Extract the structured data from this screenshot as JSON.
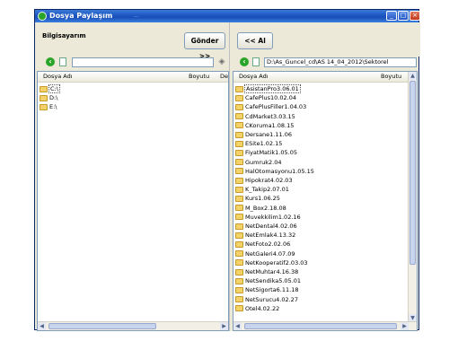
{
  "window": {
    "title": "Dosya Paylaşım",
    "faint_title_text": "...",
    "buttons": {
      "minimize": "_",
      "maximize": "□",
      "close": "×"
    }
  },
  "left": {
    "panel_title": "Bilgisayarım",
    "send_button": "Gönder >>",
    "path": "",
    "columns": {
      "name": "Dosya Adı",
      "size": "Boyutu",
      "modified": "Değ"
    },
    "items": [
      "C:\\",
      "D:\\",
      "E:\\"
    ],
    "selected_index": 0
  },
  "right": {
    "get_all_button": "<< Al",
    "path": "D:\\As_Guncel_cd\\AS 14_04_2012\\Sektorel",
    "columns": {
      "name": "Dosya Adı",
      "size": "Boyutu"
    },
    "items": [
      "AsistanPro3.06.01",
      "CafePlus10.02.04",
      "CafePlusFiller1.04.03",
      "CdMarket3.03.15",
      "CKoruma1.08.15",
      "Dersane1.11.06",
      "ESite1.02.15",
      "FiyatMatik1.05.05",
      "Gumruk2.04",
      "HalOtomasyonu1.05.15",
      "Hipokrat4.02.03",
      "K_Takip2.07.01",
      "Kurs1.06.25",
      "M_Box2.18.08",
      "Muvekkilim1.02.16",
      "NetDental4.02.06",
      "NetEmlak4.13.32",
      "NetFoto2.02.06",
      "NetGaleri4.07.09",
      "NetKooperatif2.03.03",
      "NetMuhtar4.16.38",
      "NetSendika5.05.01",
      "NetSigorta6.11.18",
      "NetSurucu4.02.27",
      "Otel4.02.22"
    ],
    "selected_index": 0
  },
  "icons": {
    "back": "back-arrow-icon",
    "page": "page-icon",
    "tool": "tag-icon",
    "folder": "folder-icon"
  },
  "colors": {
    "titlebar": "#1c55c2",
    "window_bg": "#ece9d8",
    "folder": "#f3d26a"
  }
}
